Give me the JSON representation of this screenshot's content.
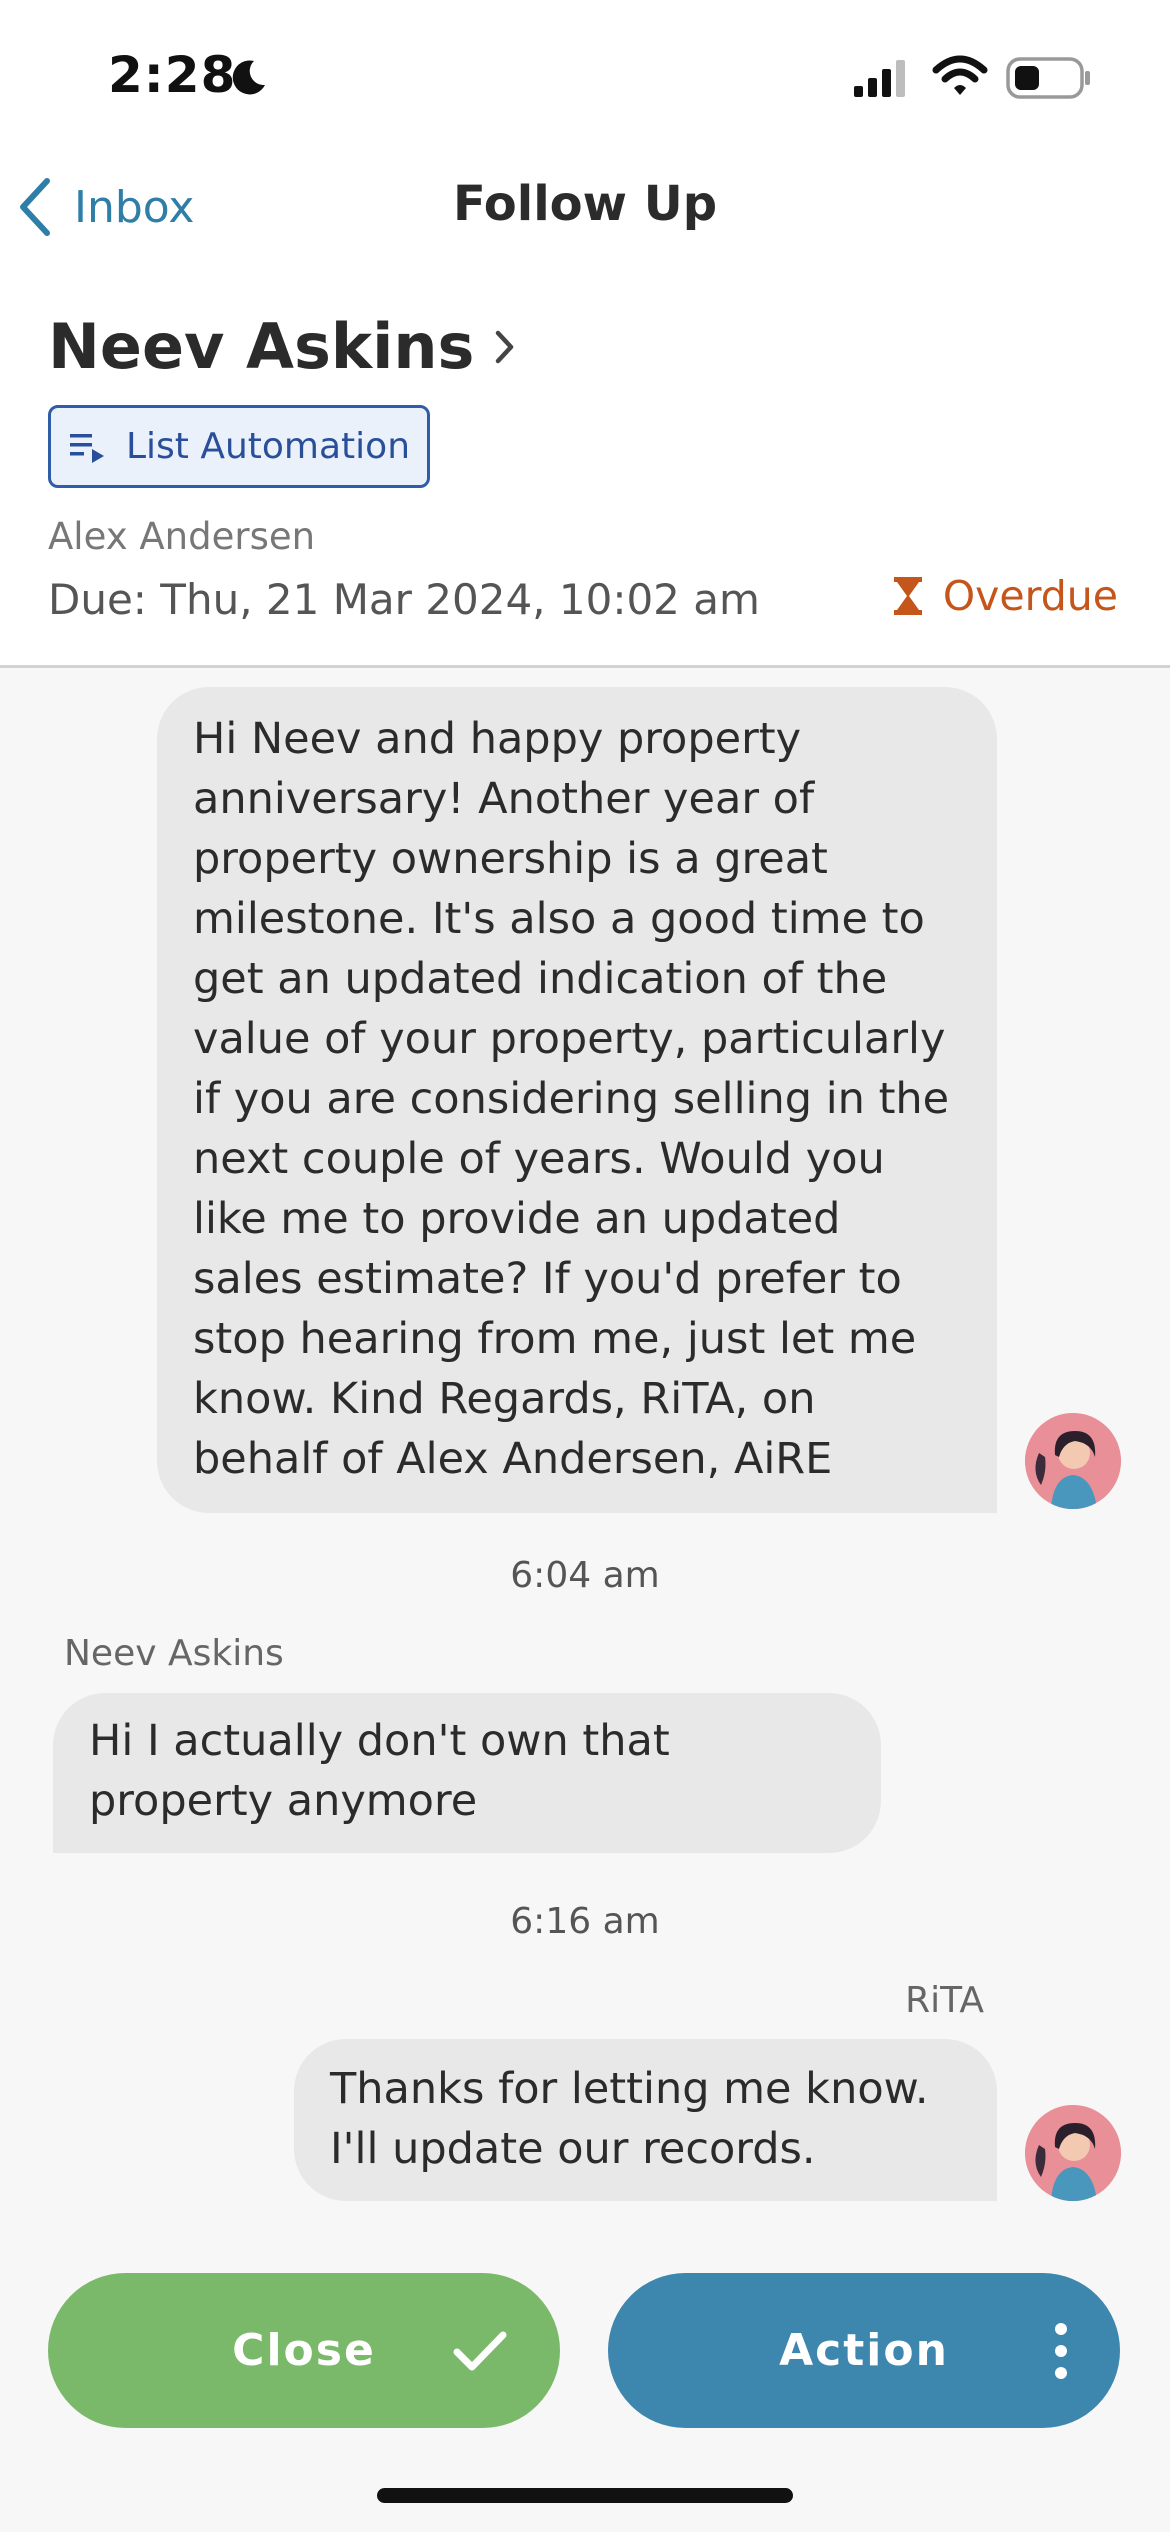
{
  "status_bar": {
    "time": "2:28"
  },
  "nav": {
    "back_label": "Inbox",
    "title": "Follow Up"
  },
  "contact": {
    "name": "Neev Askins",
    "tag_label": "List Automation",
    "assignee": "Alex Andersen",
    "due": "Due: Thu, 21 Mar 2024, 10:02 am",
    "status": "Overdue"
  },
  "messages": [
    {
      "text": "Hi Neev and happy property anniversary! Another year of property ownership is a great milestone. It's also a good time to get an updated indication of the value of your property, particularly if you are considering selling in the next couple of years. Would you like me to provide an updated sales estimate? If you'd prefer to stop hearing from me, just let me know. Kind Regards, RiTA, on behalf of Alex Andersen, AiRE"
    },
    {
      "timestamp": "6:04 am",
      "sender": "Neev Askins",
      "text": "Hi I actually don't own that property anymore"
    },
    {
      "timestamp": "6:16 am",
      "sender": "RiTA",
      "text": "Thanks for letting me know. I'll update our records."
    }
  ],
  "buttons": {
    "close": "Close",
    "action": "Action"
  },
  "colors": {
    "accent": "#2f7ea8",
    "overdue": "#c5561b",
    "close_button": "#7ab86a",
    "action_button": "#3d86ad",
    "bubble": "#e8e8e8"
  },
  "icons": [
    "moon-icon",
    "signal-icon",
    "wifi-icon",
    "battery-icon",
    "chevron-left-icon",
    "chevron-right-icon",
    "playlist-icon",
    "hourglass-icon",
    "avatar",
    "checkmark-icon",
    "more-vertical-icon"
  ]
}
